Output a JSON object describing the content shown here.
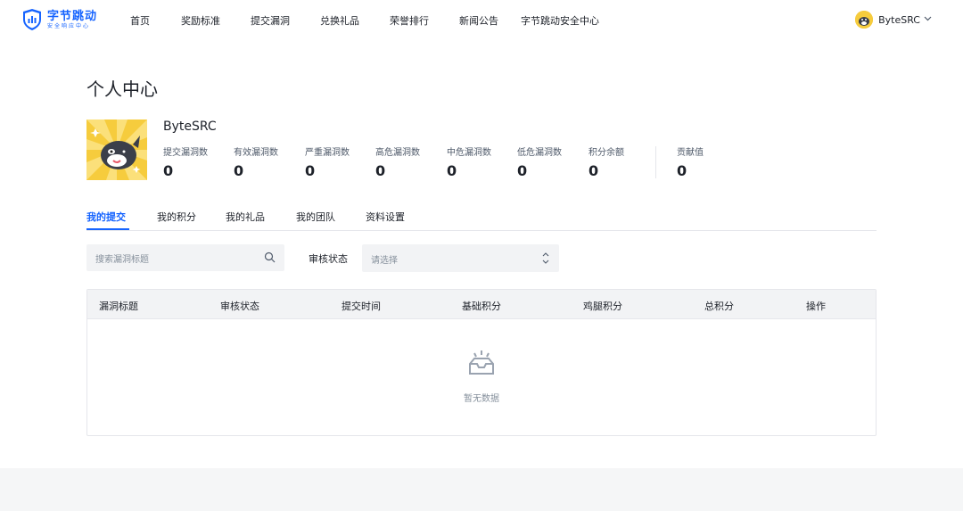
{
  "brand": {
    "title": "字节跳动",
    "subtitle": "安全响应中心",
    "color": "#1664ff"
  },
  "nav": {
    "items": [
      {
        "label": "首页"
      },
      {
        "label": "奖励标准"
      },
      {
        "label": "提交漏洞"
      },
      {
        "label": "兑换礼品"
      },
      {
        "label": "荣誉排行"
      },
      {
        "label": "新闻公告"
      },
      {
        "label": "字节跳动安全中心"
      }
    ],
    "user": {
      "name": "ByteSRC",
      "dropdown_icon": "chevron-down-icon"
    }
  },
  "page": {
    "title": "个人中心"
  },
  "profile": {
    "name": "ByteSRC",
    "stats": [
      {
        "label": "提交漏洞数",
        "value": "0"
      },
      {
        "label": "有效漏洞数",
        "value": "0"
      },
      {
        "label": "严重漏洞数",
        "value": "0"
      },
      {
        "label": "高危漏洞数",
        "value": "0"
      },
      {
        "label": "中危漏洞数",
        "value": "0"
      },
      {
        "label": "低危漏洞数",
        "value": "0"
      },
      {
        "label": "积分余额",
        "value": "0"
      },
      {
        "label": "贡献值",
        "value": "0"
      }
    ]
  },
  "tabs": [
    {
      "label": "我的提交",
      "active": true
    },
    {
      "label": "我的积分"
    },
    {
      "label": "我的礼品"
    },
    {
      "label": "我的团队"
    },
    {
      "label": "资料设置"
    }
  ],
  "filters": {
    "search_placeholder": "搜索漏洞标题",
    "status_label": "审核状态",
    "status_placeholder": "请选择"
  },
  "table": {
    "columns": [
      "漏洞标题",
      "审核状态",
      "提交时间",
      "基础积分",
      "鸡腿积分",
      "总积分",
      "操作"
    ],
    "rows": [],
    "empty_text": "暂无数据"
  },
  "colors": {
    "accent": "#1664ff",
    "avatar_bg": "#f6cc3d"
  }
}
